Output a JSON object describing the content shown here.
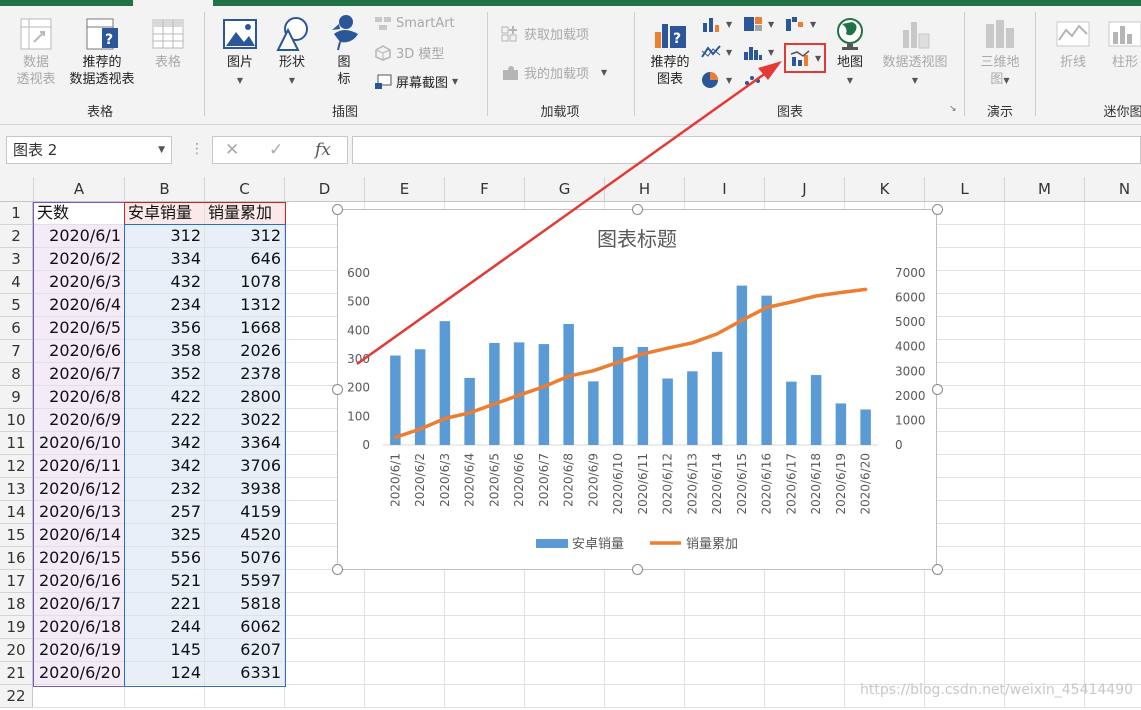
{
  "ribbon": {
    "groups": {
      "table": "表格",
      "illustrations": "插图",
      "addins": "加载项",
      "charts": "图表",
      "tours": "演示",
      "sparklines": "迷你图"
    },
    "table_group": {
      "pivot_line1": "数据",
      "pivot_line2": "透视表",
      "rec_pivot_line1": "推荐的",
      "rec_pivot_line2": "数据透视表",
      "table": "表格"
    },
    "illustrations": {
      "pictures": "图片",
      "shapes": "形状",
      "icons_line1": "图",
      "icons_line2": "标",
      "smartart": "SmartArt",
      "model3d": "3D 模型",
      "screenshot": "屏幕截图"
    },
    "addins": {
      "get": "获取加载项",
      "mine": "我的加载项"
    },
    "charts": {
      "recommended_line1": "推荐的",
      "recommended_line2": "图表",
      "maps": "地图",
      "pivot_chart": "数据透视图"
    },
    "tours": {
      "map3d_line1": "三维地",
      "map3d_line2": "图"
    },
    "sparklines": {
      "line": "折线",
      "column": "柱形"
    }
  },
  "formula_bar": {
    "name_box": "图表 2",
    "fx": "fx",
    "value": ""
  },
  "columns": [
    "A",
    "B",
    "C",
    "D",
    "E",
    "F",
    "G",
    "H",
    "I",
    "J",
    "K",
    "L",
    "M",
    "N"
  ],
  "rows": [
    {
      "n": "1",
      "a": "天数",
      "b": "安卓销量",
      "c": "销量累加"
    },
    {
      "n": "2",
      "a": "2020/6/1",
      "b": "312",
      "c": "312"
    },
    {
      "n": "3",
      "a": "2020/6/2",
      "b": "334",
      "c": "646"
    },
    {
      "n": "4",
      "a": "2020/6/3",
      "b": "432",
      "c": "1078"
    },
    {
      "n": "5",
      "a": "2020/6/4",
      "b": "234",
      "c": "1312"
    },
    {
      "n": "6",
      "a": "2020/6/5",
      "b": "356",
      "c": "1668"
    },
    {
      "n": "7",
      "a": "2020/6/6",
      "b": "358",
      "c": "2026"
    },
    {
      "n": "8",
      "a": "2020/6/7",
      "b": "352",
      "c": "2378"
    },
    {
      "n": "9",
      "a": "2020/6/8",
      "b": "422",
      "c": "2800"
    },
    {
      "n": "10",
      "a": "2020/6/9",
      "b": "222",
      "c": "3022"
    },
    {
      "n": "11",
      "a": "2020/6/10",
      "b": "342",
      "c": "3364"
    },
    {
      "n": "12",
      "a": "2020/6/11",
      "b": "342",
      "c": "3706"
    },
    {
      "n": "13",
      "a": "2020/6/12",
      "b": "232",
      "c": "3938"
    },
    {
      "n": "14",
      "a": "2020/6/13",
      "b": "257",
      "c": "4159"
    },
    {
      "n": "15",
      "a": "2020/6/14",
      "b": "325",
      "c": "4520"
    },
    {
      "n": "16",
      "a": "2020/6/15",
      "b": "556",
      "c": "5076"
    },
    {
      "n": "17",
      "a": "2020/6/16",
      "b": "521",
      "c": "5597"
    },
    {
      "n": "18",
      "a": "2020/6/17",
      "b": "221",
      "c": "5818"
    },
    {
      "n": "19",
      "a": "2020/6/18",
      "b": "244",
      "c": "6062"
    },
    {
      "n": "20",
      "a": "2020/6/19",
      "b": "145",
      "c": "6207"
    },
    {
      "n": "21",
      "a": "2020/6/20",
      "b": "124",
      "c": "6331"
    },
    {
      "n": "22",
      "a": "",
      "b": "",
      "c": ""
    }
  ],
  "chart_data": {
    "type": "bar",
    "combo": "bar+line (secondary axis)",
    "title": "图表标题",
    "categories": [
      "2020/6/1",
      "2020/6/2",
      "2020/6/3",
      "2020/6/4",
      "2020/6/5",
      "2020/6/6",
      "2020/6/7",
      "2020/6/8",
      "2020/6/9",
      "2020/6/10",
      "2020/6/11",
      "2020/6/12",
      "2020/6/13",
      "2020/6/14",
      "2020/6/15",
      "2020/6/16",
      "2020/6/17",
      "2020/6/18",
      "2020/6/19",
      "2020/6/20"
    ],
    "series": [
      {
        "name": "安卓销量",
        "type": "bar",
        "axis": "primary",
        "color": "#5b9bd5",
        "values": [
          312,
          334,
          432,
          234,
          356,
          358,
          352,
          422,
          222,
          342,
          342,
          232,
          257,
          325,
          556,
          521,
          221,
          244,
          145,
          124
        ]
      },
      {
        "name": "销量累加",
        "type": "line",
        "axis": "secondary",
        "color": "#ed7d31",
        "values": [
          312,
          646,
          1078,
          1312,
          1668,
          2026,
          2378,
          2800,
          3022,
          3364,
          3706,
          3938,
          4159,
          4520,
          5076,
          5597,
          5818,
          6062,
          6207,
          6331
        ]
      }
    ],
    "ylim": [
      0,
      600
    ],
    "yticks": [
      "0",
      "100",
      "200",
      "300",
      "400",
      "500",
      "600"
    ],
    "y2lim": [
      0,
      7000
    ],
    "y2ticks": [
      "0",
      "1000",
      "2000",
      "3000",
      "4000",
      "5000",
      "6000",
      "7000"
    ],
    "legend": "bottom",
    "grid": false
  },
  "watermark": "https://blog.csdn.net/weixin_45414490",
  "colors": {
    "excel_green": "#217346",
    "highlight_red": "#e53935",
    "bar_blue": "#5b9bd5",
    "line_orange": "#ed7d31"
  }
}
